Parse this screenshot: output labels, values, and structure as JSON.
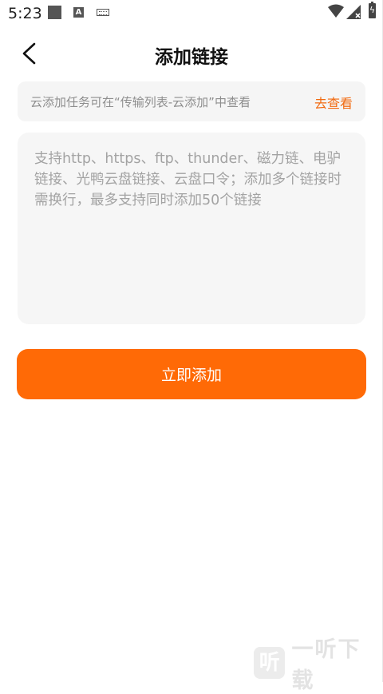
{
  "status_bar": {
    "time": "5:23",
    "icons": [
      "square-notification-icon",
      "a-notification-icon",
      "keyboard-icon",
      "wifi-icon",
      "signal-icon",
      "battery-charging-icon"
    ]
  },
  "header": {
    "title": "添加链接",
    "back_icon": "chevron-left-icon"
  },
  "notice": {
    "text": "云添加任务可在“传输列表-云添加”中查看",
    "link_label": "去查看",
    "link_color": "#f26a10"
  },
  "input": {
    "value": "",
    "placeholder": "支持http、https、ftp、thunder、磁力链、电驴链接、光鸭云盘链接、云盘口令；添加多个链接时需换行，最多支持同时添加50个链接"
  },
  "submit": {
    "label": "立即添加",
    "color": "#ff6a06"
  },
  "watermark": {
    "logo_glyph": "听",
    "text": "一听下载"
  }
}
